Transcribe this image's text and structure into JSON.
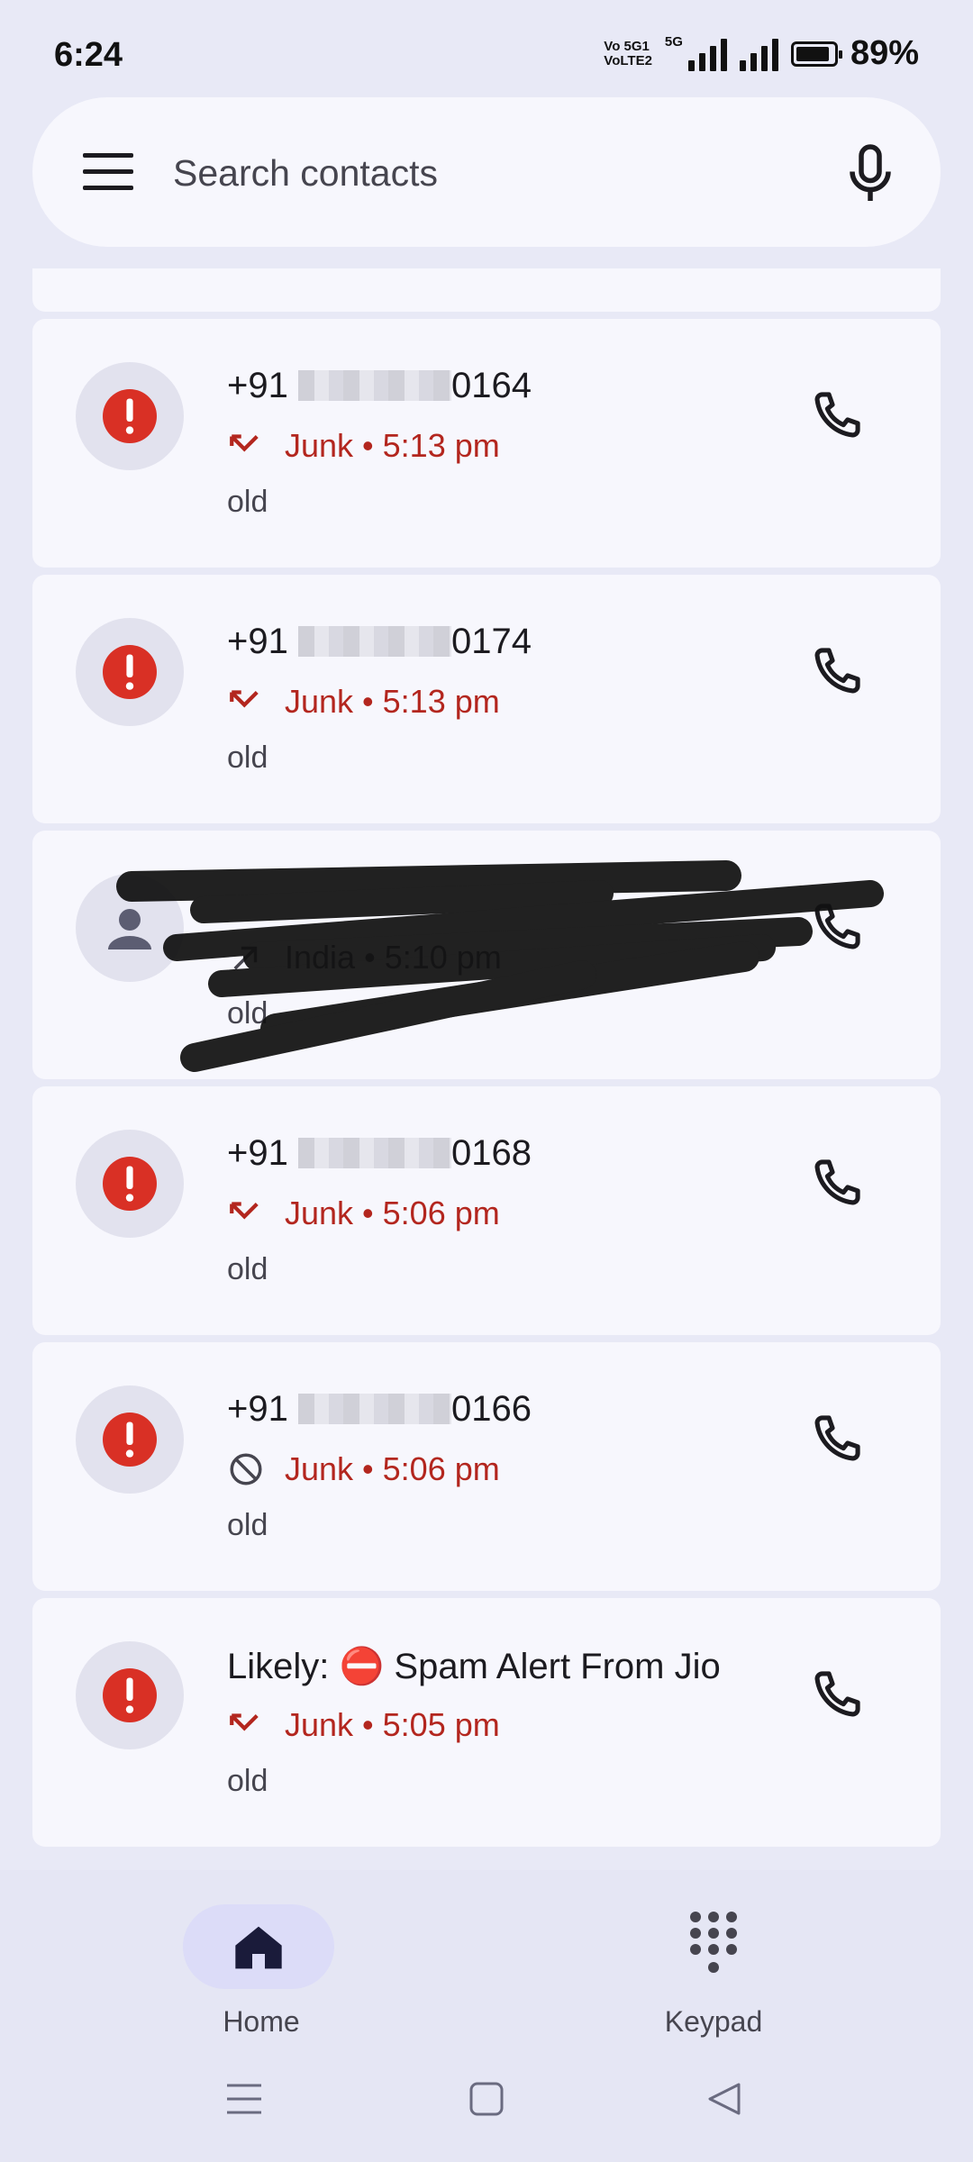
{
  "status_bar": {
    "time": "6:24",
    "network_label": "Vo 5G1\nVoLTE2",
    "network_type": "5G",
    "battery_percent": "89%",
    "battery_level": 0.89
  },
  "search": {
    "placeholder": "Search contacts",
    "menu_icon": "hamburger-menu-icon",
    "mic_icon": "microphone-icon"
  },
  "calls": [
    {
      "name_prefix": "+91 ",
      "name_suffix": "0164",
      "name_hidden": true,
      "call_icon": "missed-call-icon",
      "status": "Junk",
      "time": "5:13 pm",
      "note": "old",
      "avatar": "spam-alert-icon"
    },
    {
      "name_prefix": "+91 ",
      "name_suffix": "0174",
      "name_hidden": true,
      "call_icon": "missed-call-icon",
      "status": "Junk",
      "time": "5:13 pm",
      "note": "old",
      "avatar": "spam-alert-icon"
    },
    {
      "name_prefix": "",
      "name_suffix": "",
      "name_hidden": false,
      "redacted": true,
      "call_icon": "outgoing-call-icon",
      "status": "India",
      "time": "5:10 pm",
      "note": "old",
      "avatar": "person-icon"
    },
    {
      "name_prefix": "+91 ",
      "name_suffix": "0168",
      "name_hidden": true,
      "call_icon": "missed-call-icon",
      "status": "Junk",
      "time": "5:06 pm",
      "note": "old",
      "avatar": "spam-alert-icon"
    },
    {
      "name_prefix": "+91 ",
      "name_suffix": "0166",
      "name_hidden": true,
      "call_icon": "blocked-call-icon",
      "status": "Junk",
      "time": "5:06 pm",
      "note": "old",
      "avatar": "spam-alert-icon"
    },
    {
      "name_prefix": "Likely: ⛔ Spam Alert From Jio",
      "name_suffix": "",
      "name_hidden": false,
      "call_icon": "missed-call-icon",
      "status": "Junk",
      "time": "5:05 pm",
      "note": "old",
      "avatar": "spam-alert-icon"
    }
  ],
  "separator": " • ",
  "bottom_nav": {
    "home_label": "Home",
    "keypad_label": "Keypad",
    "selected": "Home"
  },
  "colors": {
    "junk_red": "#b3261e",
    "alert_red": "#d93025",
    "accent_pill": "#dcdcf8"
  }
}
